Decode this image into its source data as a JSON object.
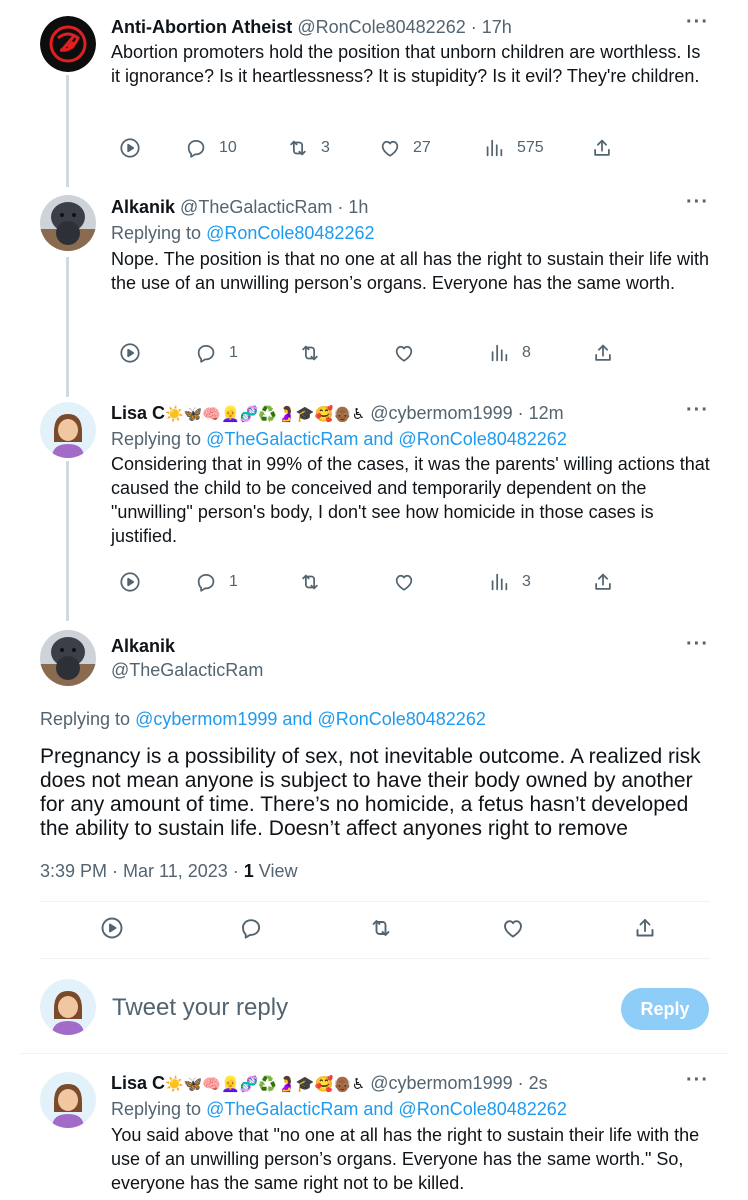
{
  "tweets": [
    {
      "name": "Anti-Abortion Atheist",
      "handle": "@RonCole80482262",
      "time": "17h",
      "body": "Abortion promoters hold the position that unborn children are worthless. Is it ignorance? Is it heartlessness? It is stupidity? Is it evil? They're children.",
      "replies": "10",
      "retweets": "3",
      "likes": "27",
      "views": "575"
    },
    {
      "name": "Alkanik",
      "handle": "@TheGalacticRam",
      "time": "1h",
      "replying_label": "Replying to",
      "replying_to": "@RonCole80482262",
      "body": "Nope. The position is that no one at all has the right to sustain their life with the use of an unwilling person’s organs. Everyone has the same worth.",
      "replies": "1",
      "retweets": "",
      "likes": "",
      "views": "8"
    },
    {
      "name": "Lisa C",
      "name_emojis": "☀️🦋🧠👱‍♀️🧬♻️🤰🎓🥰👴🏾♿",
      "handle": "@cybermom1999",
      "time": "12m",
      "replying_label": "Replying to",
      "replying_to": "@TheGalacticRam and @RonCole80482262",
      "body": "Considering that in 99% of the cases, it was the parents' willing actions that caused the child to be conceived and temporarily dependent on the \"unwilling\" person's body, I don't see how homicide in those cases is justified.",
      "replies": "1",
      "retweets": "",
      "likes": "",
      "views": "3"
    }
  ],
  "main": {
    "name": "Alkanik",
    "handle": "@TheGalacticRam",
    "replying_label": "Replying to",
    "replying_to": "@cybermom1999 and @RonCole80482262",
    "body": "Pregnancy is a possibility of sex, not inevitable outcome. A realized risk does not mean anyone is subject to have their body owned by another for any amount of time. There’s no homicide, a fetus hasn’t developed the ability to sustain life. Doesn’t affect anyones right to remove",
    "timestamp": "3:39 PM · Mar 11, 2023 · ",
    "view_count": "1",
    "view_label": " View"
  },
  "reply_box": {
    "placeholder": "Tweet your reply",
    "button": "Reply"
  },
  "last_reply": {
    "name": "Lisa C",
    "name_emojis": "☀️🦋🧠👱‍♀️🧬♻️🤰🎓🥰👴🏾♿",
    "handle": "@cybermom1999",
    "time": "2s",
    "replying_label": "Replying to",
    "replying_to": "@TheGalacticRam and @RonCole80482262",
    "body": "You said above that \"no one at all has the right to sustain their life with the use of an unwilling person’s organs. Everyone has the same worth.\" So, everyone has the same right not to be killed."
  },
  "colors": {
    "accent": "#1d9bf0",
    "muted": "#536471",
    "reply_button": "#8ecdf8"
  },
  "icons": [
    "reply-icon",
    "retweet-icon",
    "like-icon",
    "views-icon",
    "share-icon",
    "video-icon",
    "more-icon"
  ]
}
